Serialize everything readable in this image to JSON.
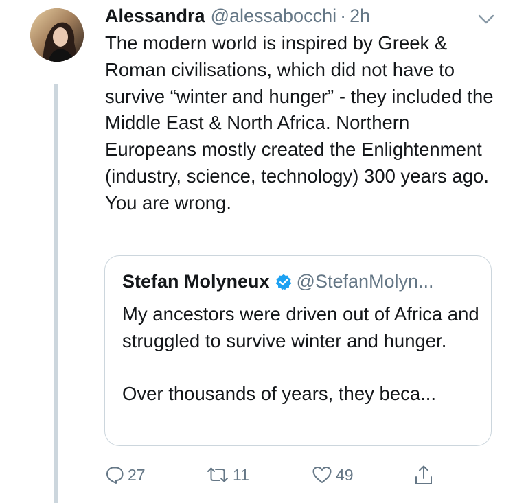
{
  "tweet": {
    "author_name": "Alessandra",
    "author_handle": "@alessabocchi",
    "separator": "·",
    "time": "2h",
    "text": "The modern world is inspired by Greek & Roman civilisations, which did not have to survive “winter and hunger” - they included the Middle East & North Africa. Northern Europeans mostly created the Enlightenment (industry, science, technology) 300 years ago. You are wrong."
  },
  "quoted_tweet": {
    "author_name": "Stefan Molyneux",
    "author_handle": "@StefanMolyn...",
    "verified": true,
    "text_paragraph_1": "My ancestors were driven out of Africa and struggled to survive winter and hunger.",
    "text_paragraph_2": "Over thousands of years, they beca..."
  },
  "actions": {
    "reply_count": "27",
    "retweet_count": "11",
    "like_count": "49"
  },
  "icons": {
    "options": "chevron-down-icon",
    "verified": "verified-badge-icon",
    "reply": "reply-icon",
    "retweet": "retweet-icon",
    "like": "heart-icon",
    "share": "share-icon"
  },
  "colors": {
    "text_primary": "#14171a",
    "text_secondary": "#657786",
    "border": "#ccd6dd",
    "verified_blue": "#1da1f2"
  }
}
